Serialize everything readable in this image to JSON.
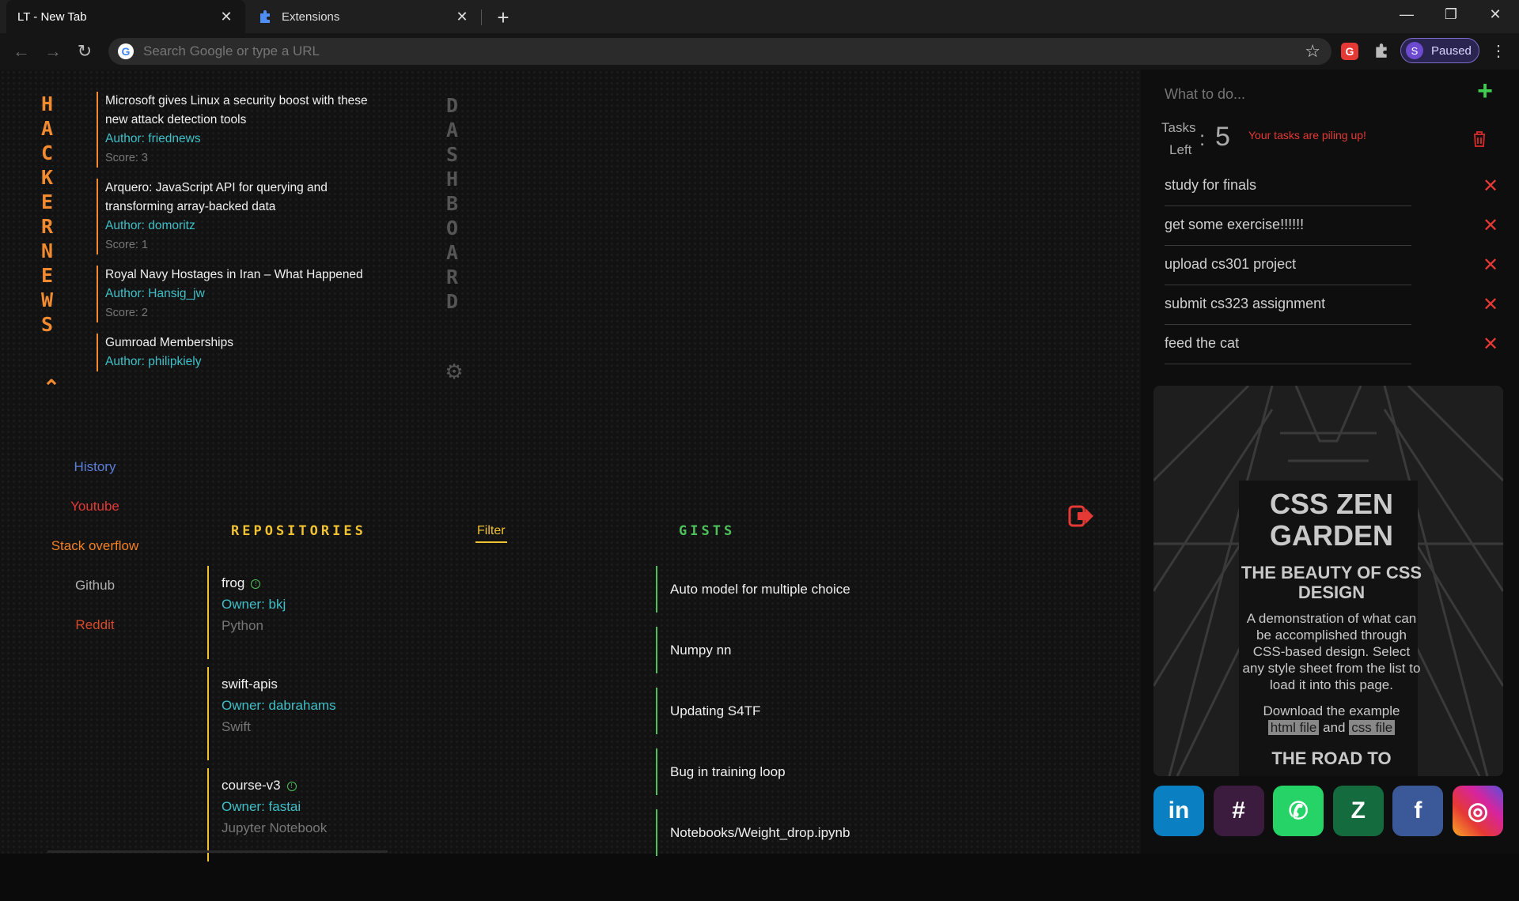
{
  "browser": {
    "tabs": [
      {
        "title": "LT - New Tab",
        "active": true
      },
      {
        "title": "Extensions",
        "active": false
      }
    ],
    "address_placeholder": "Search Google or type a URL",
    "profile_initial": "S",
    "profile_status": "Paused",
    "ext_letter": "G"
  },
  "hackernews": {
    "title_letters": [
      "H",
      "A",
      "C",
      "K",
      "E",
      "R",
      "N",
      "E",
      "W",
      "S"
    ],
    "items": [
      {
        "title": "Microsoft gives Linux a security boost with these new attack detection tools",
        "author": "Author: friednews",
        "score": "Score: 3"
      },
      {
        "title": "Arquero: JavaScript API for querying and transforming array-backed data",
        "author": "Author: domoritz",
        "score": "Score: 1"
      },
      {
        "title": "Royal Navy Hostages in Iran – What Happened",
        "author": "Author: Hansig_jw",
        "score": "Score: 2"
      },
      {
        "title": "Gumroad Memberships",
        "author": "Author: philipkiely",
        "score": ""
      }
    ]
  },
  "dashboard": {
    "title_letters": [
      "D",
      "A",
      "S",
      "H",
      "B",
      "O",
      "A",
      "R",
      "D"
    ]
  },
  "bookmarks": [
    {
      "label": "History",
      "color": "#5b7fd6"
    },
    {
      "label": "Youtube",
      "color": "#e53935"
    },
    {
      "label": "Stack overflow",
      "color": "#f48024"
    },
    {
      "label": "Github",
      "color": "#b0b0b0"
    },
    {
      "label": "Reddit",
      "color": "#d94a2b"
    }
  ],
  "repos": {
    "heading": "REPOSITORIES",
    "filter_label": "Filter",
    "items": [
      {
        "name": "frog",
        "owner": "Owner: bkj",
        "lang": "Python",
        "badge": true
      },
      {
        "name": "swift-apis",
        "owner": "Owner: dabrahams",
        "lang": "Swift",
        "badge": false
      },
      {
        "name": "course-v3",
        "owner": "Owner: fastai",
        "lang": "Jupyter Notebook",
        "badge": true
      }
    ]
  },
  "gists": {
    "heading": "GISTS",
    "items": [
      "Auto model for multiple choice",
      "Numpy nn",
      "Updating S4TF",
      "Bug in training loop",
      "Notebooks/Weight_drop.ipynb"
    ]
  },
  "todo": {
    "input_placeholder": "What to do...",
    "tasks_label_1": "Tasks",
    "tasks_label_2": "Left",
    "tasks_count": "5",
    "warning": "Your tasks are piling up!",
    "items": [
      "study for finals",
      "get some exercise!!!!!!",
      "upload cs301 project",
      "submit cs323 assignment",
      "feed the cat"
    ]
  },
  "zen": {
    "h1": "CSS ZEN GARDEN",
    "h2": "THE BEAUTY OF CSS DESIGN",
    "p1": "A demonstration of what can be accomplished through CSS-based design. Select any style sheet from the list to load it into this page.",
    "p2_pre": "Download the example",
    "html_link": "html file",
    "and": "and",
    "css_link": "css file",
    "h3": "THE ROAD TO"
  },
  "socials": [
    {
      "name": "linkedin",
      "glyph": "in",
      "color": "#0a7fc2"
    },
    {
      "name": "slack",
      "glyph": "#",
      "color": "#3b1c3f"
    },
    {
      "name": "whatsapp",
      "glyph": "✆",
      "color": "#25d366"
    },
    {
      "name": "zendesk",
      "glyph": "Z",
      "color": "#136b3e"
    },
    {
      "name": "facebook",
      "glyph": "f",
      "color": "#3b5998"
    },
    {
      "name": "instagram",
      "glyph": "◎",
      "color": "#d6249f"
    }
  ]
}
